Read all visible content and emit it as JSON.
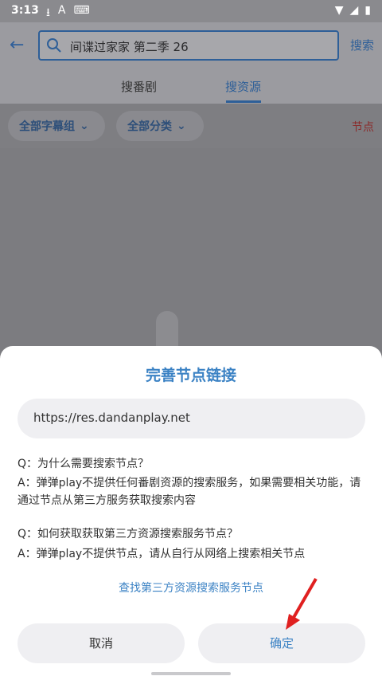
{
  "status": {
    "time": "3:13"
  },
  "header": {
    "search_value": "间谍过家家 第二季 26",
    "search_button": "搜索",
    "tabs": [
      "搜番剧",
      "搜资源"
    ]
  },
  "filters": {
    "subtitle_group": "全部字幕组",
    "category": "全部分类",
    "node": "节点"
  },
  "dialog": {
    "title": "完善节点链接",
    "url": "https://res.dandanplay.net",
    "q1": "Q：为什么需要搜索节点？",
    "a1": "A：弹弹play不提供任何番剧资源的搜索服务，如果需要相关功能，请通过节点从第三方服务获取搜索内容",
    "q2": "Q：如何获取获取第三方资源搜索服务节点？",
    "a2": "A：弹弹play不提供节点，请从自行从网络上搜索相关节点",
    "find_link": "查找第三方资源搜索服务节点",
    "cancel": "取消",
    "confirm": "确定"
  },
  "colors": {
    "accent": "#3b82c4",
    "annotation_arrow": "#e02020"
  }
}
